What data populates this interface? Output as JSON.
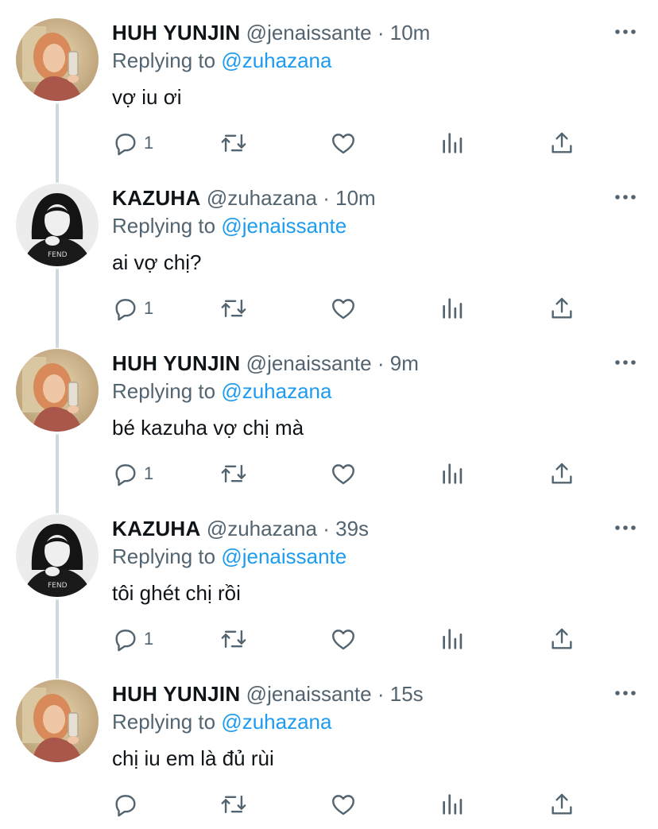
{
  "thread": [
    {
      "author": "yunjin",
      "name": "HUH YUNJIN",
      "handle": "@jenaissante",
      "time": "10m",
      "replying_label": "Replying to",
      "replying_to": "@zuhazana",
      "text": "vợ iu ơi",
      "reply_count": "1"
    },
    {
      "author": "kazuha",
      "name": "KAZUHA",
      "handle": "@zuhazana",
      "time": "10m",
      "replying_label": "Replying to",
      "replying_to": "@jenaissante",
      "text": "ai vợ chị?",
      "reply_count": "1"
    },
    {
      "author": "yunjin",
      "name": "HUH YUNJIN",
      "handle": "@jenaissante",
      "time": "9m",
      "replying_label": "Replying to",
      "replying_to": "@zuhazana",
      "text": "bé kazuha vợ chị mà",
      "reply_count": "1"
    },
    {
      "author": "kazuha",
      "name": "KAZUHA",
      "handle": "@zuhazana",
      "time": "39s",
      "replying_label": "Replying to",
      "replying_to": "@jenaissante",
      "text": "tôi ghét chị rồi",
      "reply_count": "1"
    },
    {
      "author": "yunjin",
      "name": "HUH YUNJIN",
      "handle": "@jenaissante",
      "time": "15s",
      "replying_label": "Replying to",
      "replying_to": "@zuhazana",
      "text": "chị iu em là đủ rùi",
      "reply_count": ""
    }
  ],
  "separator": "·",
  "icons": {
    "reply": "reply-icon",
    "retweet": "retweet-icon",
    "like": "heart-icon",
    "stats": "analytics-icon",
    "share": "share-icon",
    "more": "more-icon"
  },
  "colors": {
    "text": "#0f1419",
    "secondary": "#536471",
    "accent": "#1d9bf0",
    "thread_line": "#cfd9de"
  }
}
